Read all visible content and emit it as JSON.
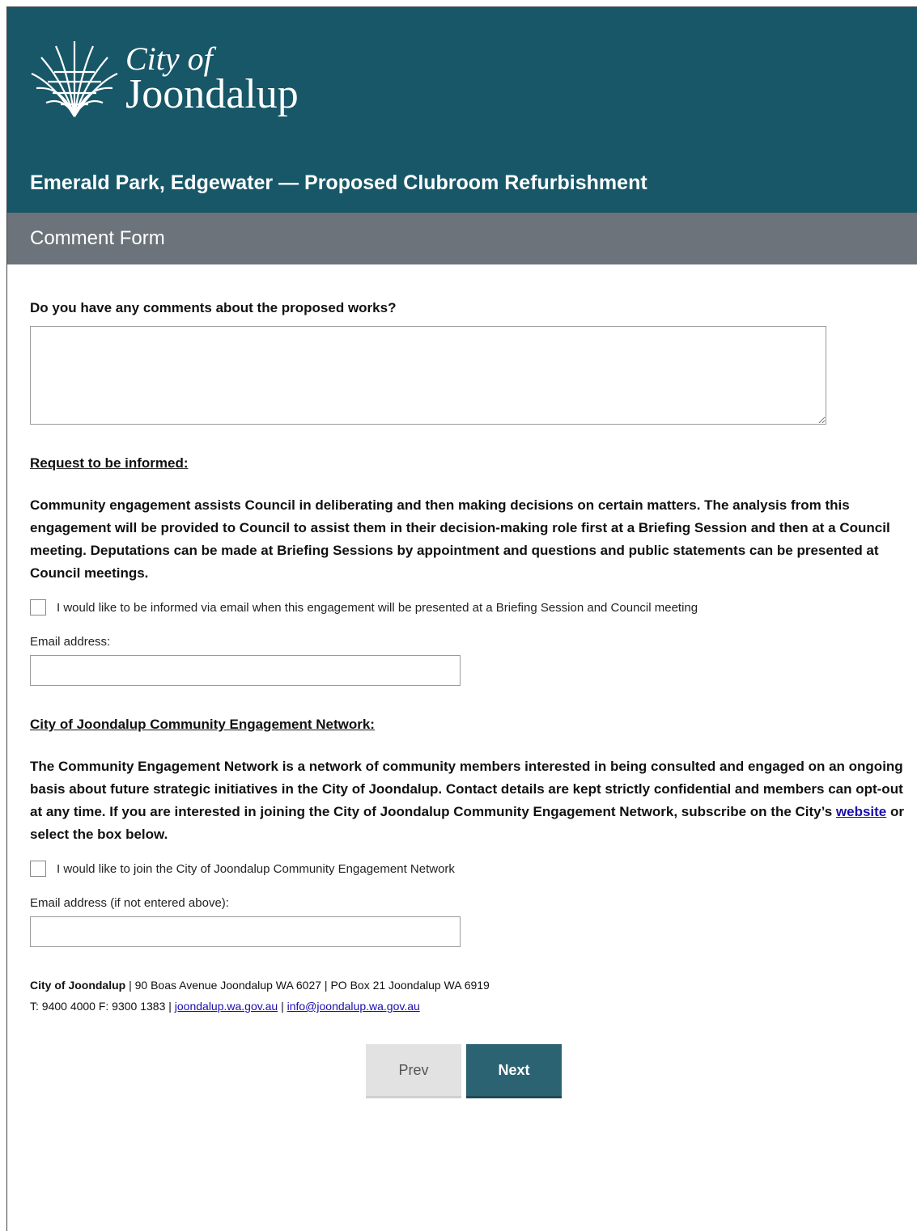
{
  "header": {
    "logo_line1": "City of",
    "logo_line2": "Joondalup",
    "title": "Emerald Park, Edgewater — Proposed Clubroom Refurbishment",
    "bg_color": "#175767"
  },
  "subbar": {
    "title": "Comment Form",
    "bg_color": "#6c737a"
  },
  "question": {
    "label": "Do you have any comments about the proposed works?",
    "value": ""
  },
  "informed": {
    "heading": "Request to be informed:",
    "paragraph": "Community engagement assists Council in deliberating and then making decisions on certain matters. The analysis from this engagement will be provided to Council to assist them in their decision-making role first at a Briefing Session and then at a Council meeting. Deputations can be made at Briefing Sessions by appointment and questions and public statements can be presented at Council meetings.",
    "checkbox_label": "I would like to be informed via email when this engagement will be presented at a Briefing Session and Council meeting",
    "checked": false,
    "email_label": "Email address:",
    "email_value": ""
  },
  "network": {
    "heading": "City of Joondalup Community Engagement Network:",
    "paragraph_before_link": "The Community Engagement Network is a network of community members interested in being consulted and engaged on an ongoing basis about future strategic initiatives in the City of Joondalup. Contact details are kept strictly confidential and members can opt-out at any time. If you are interested in joining the City of Joondalup Community Engagement Network, subscribe on the City’s ",
    "link_text": "website",
    "paragraph_after_link": " or select the box below.",
    "checkbox_label": "I would like to join the City of Joondalup Community Engagement Network",
    "checked": false,
    "email_label": "Email address (if not entered above):",
    "email_value": ""
  },
  "footer": {
    "org": "City of Joondalup",
    "address": " | 90 Boas Avenue Joondalup WA 6027 | PO Box 21 Joondalup WA 6919",
    "phone": "T: 9400 4000 F: 9300 1383 | ",
    "website": "joondalup.wa.gov.au",
    "separator": " | ",
    "email": "info@joondalup.wa.gov.au"
  },
  "nav": {
    "prev_label": "Prev",
    "next_label": "Next",
    "next_color": "#2b6373"
  }
}
